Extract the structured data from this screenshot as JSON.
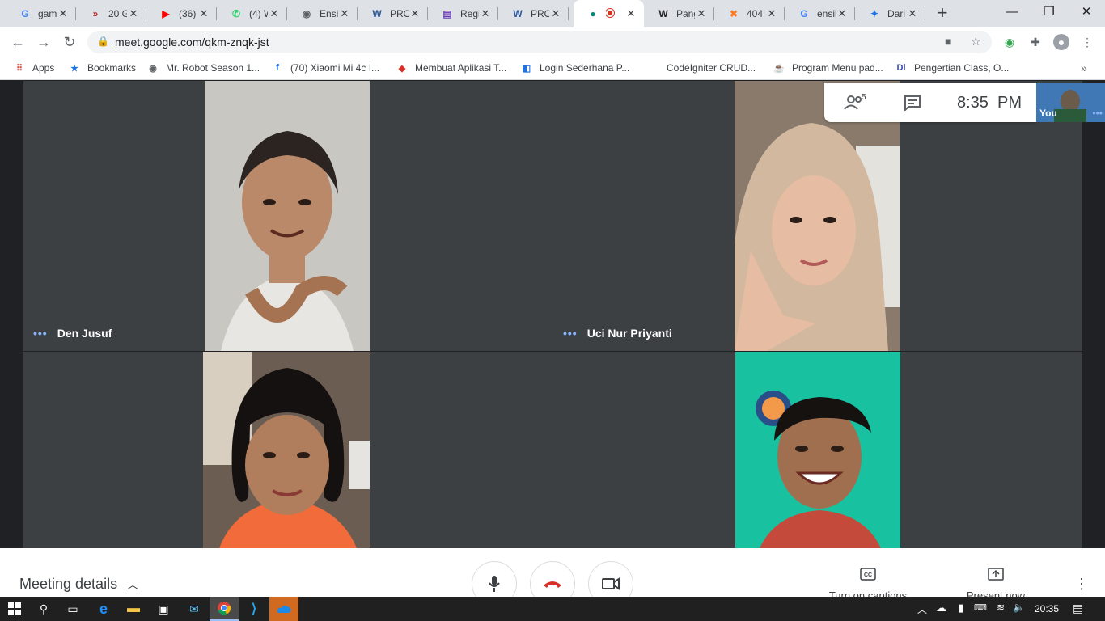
{
  "browser": {
    "tabs": [
      {
        "label": "gam",
        "icon": "google-icon",
        "favText": "G",
        "favColor": "#4285f4"
      },
      {
        "label": "20 G",
        "icon": "chevron-brand-icon",
        "favText": "»",
        "favColor": "#c5221f"
      },
      {
        "label": "(36)",
        "icon": "youtube-icon",
        "favText": "▶",
        "favColor": "#ff0000"
      },
      {
        "label": "(4) W",
        "icon": "whatsapp-icon",
        "favText": "✆",
        "favColor": "#25d366"
      },
      {
        "label": "Ensi",
        "icon": "globe-icon",
        "favText": "◉",
        "favColor": "#5f6368"
      },
      {
        "label": "PRO",
        "icon": "word-icon",
        "favText": "W",
        "favColor": "#2b579a"
      },
      {
        "label": "Regi",
        "icon": "forms-icon",
        "favText": "▤",
        "favColor": "#673ab7"
      },
      {
        "label": "PRO",
        "icon": "word-icon",
        "favText": "W",
        "favColor": "#2b579a"
      },
      {
        "label": "",
        "icon": "meet-icon",
        "favText": "●",
        "favColor": "#00897b"
      },
      {
        "label": "Pang",
        "icon": "wikipedia-icon",
        "favText": "W",
        "favColor": "#202124"
      },
      {
        "label": "404",
        "icon": "xampp-icon",
        "favText": "✖",
        "favColor": "#fb7a24"
      },
      {
        "label": "ensil",
        "icon": "google-icon",
        "favText": "G",
        "favColor": "#4285f4"
      },
      {
        "label": "Dari",
        "icon": "translate-icon",
        "favText": "✦",
        "favColor": "#1a73e8"
      }
    ],
    "url": "meet.google.com/qkm-znqk-jst",
    "bookmarks": [
      {
        "label": "Apps",
        "favText": "⠿",
        "favColor": "#ea4335"
      },
      {
        "label": "Bookmarks",
        "favText": "★",
        "favColor": "#1a73e8"
      },
      {
        "label": "Mr. Robot Season 1...",
        "favText": "◉",
        "favColor": "#5f6368"
      },
      {
        "label": "(70) Xiaomi Mi 4c I...",
        "favText": "f",
        "favColor": "#1877f2"
      },
      {
        "label": "Membuat Aplikasi T...",
        "favText": "◆",
        "favColor": "#d93025"
      },
      {
        "label": "Login Sederhana P...",
        "favText": "◧",
        "favColor": "#1a73e8"
      },
      {
        "label": "CodeIgniter CRUD...",
        "favText": "",
        "favColor": "#ffffff"
      },
      {
        "label": "Program Menu pad...",
        "favText": "☕",
        "favColor": "#795548"
      },
      {
        "label": "Pengertian Class, O...",
        "favText": "Di",
        "favColor": "#3949ab"
      }
    ]
  },
  "meet": {
    "participants_count": "5",
    "time": "8:35  PM",
    "self_label": "You",
    "participants": [
      {
        "name": "Den Jusuf",
        "skin": "#b9896a",
        "bg": "#c9c7c2",
        "shirt": "#e8e6e2",
        "hair": "#2b2420"
      },
      {
        "name": "Uci Nur Priyanti",
        "skin": "#e6bda2",
        "bg": "#8a7a6c",
        "shirt": "#cdb9a6",
        "hair": "#d2b89e"
      },
      {
        "name": "",
        "skin": "#b07e5c",
        "bg": "#6b5d52",
        "shirt": "#f26b3a",
        "hair": "#141110"
      },
      {
        "name": "",
        "skin": "#a06f4f",
        "bg": "#18c2a0",
        "shirt": "#c44b3b",
        "hair": "#161210"
      }
    ],
    "meeting_details": "Meeting details",
    "captions": "Turn on captions",
    "present": "Present now"
  },
  "taskbar": {
    "clock": "20:35"
  }
}
